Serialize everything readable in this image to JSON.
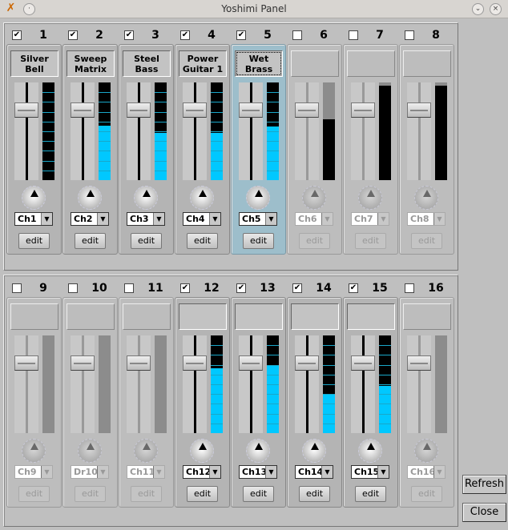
{
  "window": {
    "title": "Yoshimi Panel"
  },
  "strips": [
    {
      "num": "1",
      "enabled": true,
      "name": "Silver Bell",
      "channel": "Ch1",
      "level": 0,
      "edit": "edit"
    },
    {
      "num": "2",
      "enabled": true,
      "name": "Sweep Matrix",
      "channel": "Ch2",
      "level": 0.56,
      "edit": "edit"
    },
    {
      "num": "3",
      "enabled": true,
      "name": "Steel Bass",
      "channel": "Ch3",
      "level": 0.48,
      "edit": "edit"
    },
    {
      "num": "4",
      "enabled": true,
      "name": "Power Guitar 1",
      "channel": "Ch4",
      "level": 0.48,
      "edit": "edit"
    },
    {
      "num": "5",
      "enabled": true,
      "selected": true,
      "name": "Wet Brass",
      "channel": "Ch5",
      "level": 0.55,
      "edit": "edit"
    },
    {
      "num": "6",
      "enabled": false,
      "name": "",
      "channel": "Ch6",
      "level": 0.62,
      "edit": "edit"
    },
    {
      "num": "7",
      "enabled": false,
      "name": "",
      "channel": "Ch7",
      "level": 0.97,
      "edit": "edit"
    },
    {
      "num": "8",
      "enabled": false,
      "name": "",
      "channel": "Ch8",
      "level": 0.97,
      "edit": "edit"
    },
    {
      "num": "9",
      "enabled": false,
      "name": "",
      "channel": "Ch9",
      "level": 0,
      "edit": "edit"
    },
    {
      "num": "10",
      "enabled": false,
      "name": "",
      "channel": "Dr10",
      "level": 0,
      "edit": "edit"
    },
    {
      "num": "11",
      "enabled": false,
      "name": "",
      "channel": "Ch11",
      "level": 0,
      "edit": "edit"
    },
    {
      "num": "12",
      "enabled": true,
      "name": "",
      "channel": "Ch12",
      "level": 0.66,
      "edit": "edit"
    },
    {
      "num": "13",
      "enabled": true,
      "name": "",
      "channel": "Ch13",
      "level": 0.69,
      "edit": "edit"
    },
    {
      "num": "14",
      "enabled": true,
      "name": "",
      "channel": "Ch14",
      "level": 0.4,
      "edit": "edit"
    },
    {
      "num": "15",
      "enabled": true,
      "name": "",
      "channel": "Ch15",
      "level": 0.48,
      "edit": "edit"
    },
    {
      "num": "16",
      "enabled": false,
      "name": "",
      "channel": "Ch16",
      "level": 0,
      "edit": "edit"
    }
  ],
  "buttons": {
    "refresh": "Refresh",
    "close": "Close"
  },
  "colors": {
    "meter": "#00c8ff",
    "selected": "#9dbecb"
  }
}
